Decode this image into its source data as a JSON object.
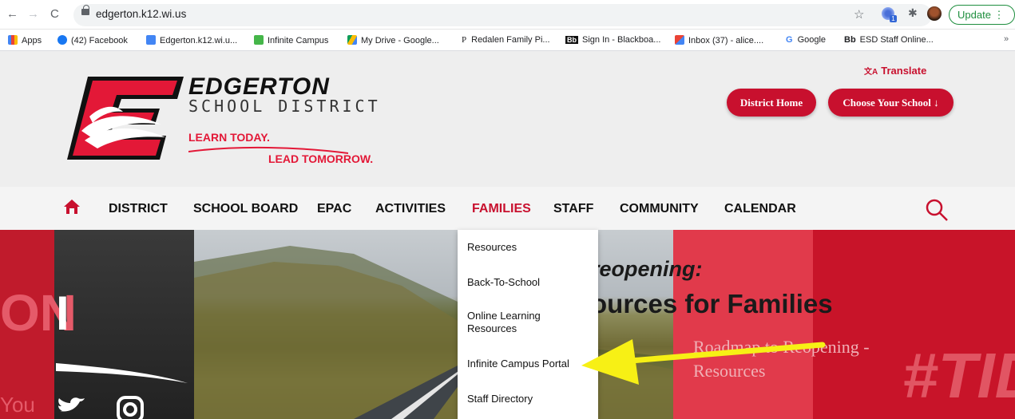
{
  "browser": {
    "url": "edgerton.k12.wi.us",
    "update_label": "Update",
    "update_more": "⋮",
    "back_icon": "←",
    "forward_icon": "→",
    "reload_icon": "C",
    "star_icon": "☆",
    "ext_badge": "1",
    "puzzle_icon": "✱"
  },
  "bookmarks": {
    "apps": "Apps",
    "items": [
      {
        "label": "(42) Facebook",
        "color": "#1877f2"
      },
      {
        "label": "Edgerton.k12.wi.u...",
        "color": "#4285f4"
      },
      {
        "label": "Infinite Campus",
        "color": "#45b649"
      },
      {
        "label": "My Drive - Google...",
        "color": "#fbbc04"
      },
      {
        "label": "Redalen Family Pi...",
        "prefix": "P"
      },
      {
        "label": "Sign In - Blackboa...",
        "prefix": "Bb"
      },
      {
        "label": "Inbox (37) - alice....",
        "color": "#ea4335"
      },
      {
        "label": "Google",
        "prefix": "G"
      },
      {
        "label": "ESD Staff Online...",
        "prefix": "Bb"
      }
    ],
    "more": "»"
  },
  "header": {
    "brand_line1": "EDGERTON",
    "brand_line2": "SCHOOL DISTRICT",
    "tagline1": "LEARN TODAY.",
    "tagline2": "LEAD TOMORROW.",
    "translate": "Translate",
    "translate_icon": "文A",
    "district_home": "District Home",
    "choose_school": "Choose Your School ↓",
    "brand_color": "#c8102e"
  },
  "nav": {
    "items": [
      "DISTRICT",
      "SCHOOL BOARD",
      "EPAC",
      "ACTIVITIES",
      "FAMILIES",
      "STAFF",
      "COMMUNITY",
      "CALENDAR"
    ],
    "active": "FAMILIES"
  },
  "dropdown": {
    "items": [
      "Resources",
      "Back-To-School",
      "Online Learning Resources",
      "Infinite Campus Portal",
      "Staff Directory"
    ]
  },
  "hero": {
    "headline1": "reopening:",
    "headline2": "ources for Families",
    "subtext1": "Roadmap to Reopening -",
    "subtext2": "Resources",
    "big_text": "#TID",
    "left_text": "ON",
    "left_text2": "I",
    "left_you": "You"
  }
}
